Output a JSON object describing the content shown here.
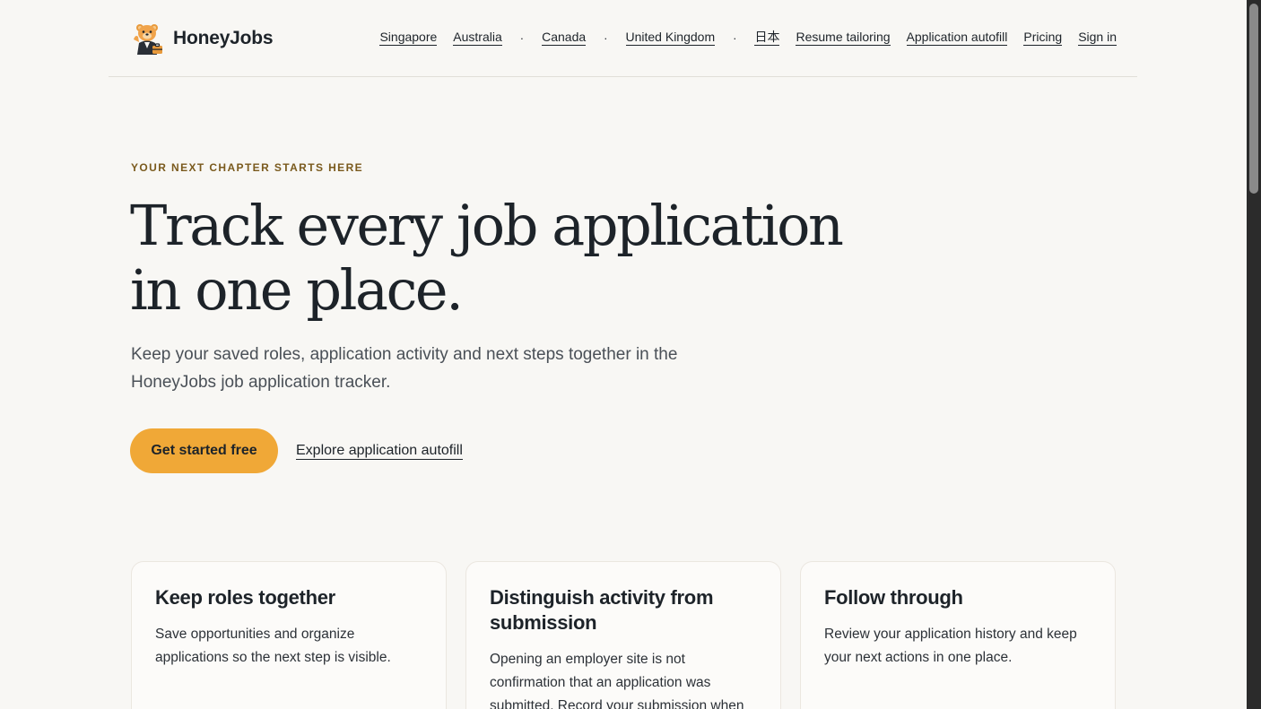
{
  "header": {
    "brand": "HoneyJobs",
    "nav": [
      {
        "label": "Singapore",
        "name": "nav-singapore"
      },
      {
        "label": "Australia",
        "name": "nav-australia"
      },
      {
        "sep": "·"
      },
      {
        "label": "Canada",
        "name": "nav-canada"
      },
      {
        "sep": "·"
      },
      {
        "label": "United Kingdom",
        "name": "nav-united-kingdom"
      },
      {
        "sep": "·"
      },
      {
        "label": "日本",
        "name": "nav-japan"
      },
      {
        "label": "Resume tailoring",
        "name": "nav-resume-tailoring"
      },
      {
        "label": "Application autofill",
        "name": "nav-application-autofill"
      },
      {
        "label": "Pricing",
        "name": "nav-pricing"
      },
      {
        "label": "Sign in",
        "name": "nav-sign-in"
      }
    ]
  },
  "hero": {
    "eyebrow": "YOUR NEXT CHAPTER STARTS HERE",
    "title": "Track every job application in one place.",
    "lede": "Keep your saved roles, application activity and next steps together in the HoneyJobs job application tracker.",
    "cta_label": "Get started free",
    "secondary_label": "Explore application autofill"
  },
  "cards": [
    {
      "title": "Keep roles together",
      "body": "Save opportunities and organize applications so the next step is visible."
    },
    {
      "title": "Distinguish activity from submission",
      "body": "Opening an employer site is not confirmation that an application was submitted. Record your submission when"
    },
    {
      "title": "Follow through",
      "body": "Review your application history and keep your next actions in one place."
    }
  ],
  "colors": {
    "accent": "#f0a837",
    "background": "#f8f7f4",
    "eyebrow": "#7a5a1d",
    "text": "#1d2329"
  },
  "icons": {
    "logo": "bear-logo-icon"
  }
}
